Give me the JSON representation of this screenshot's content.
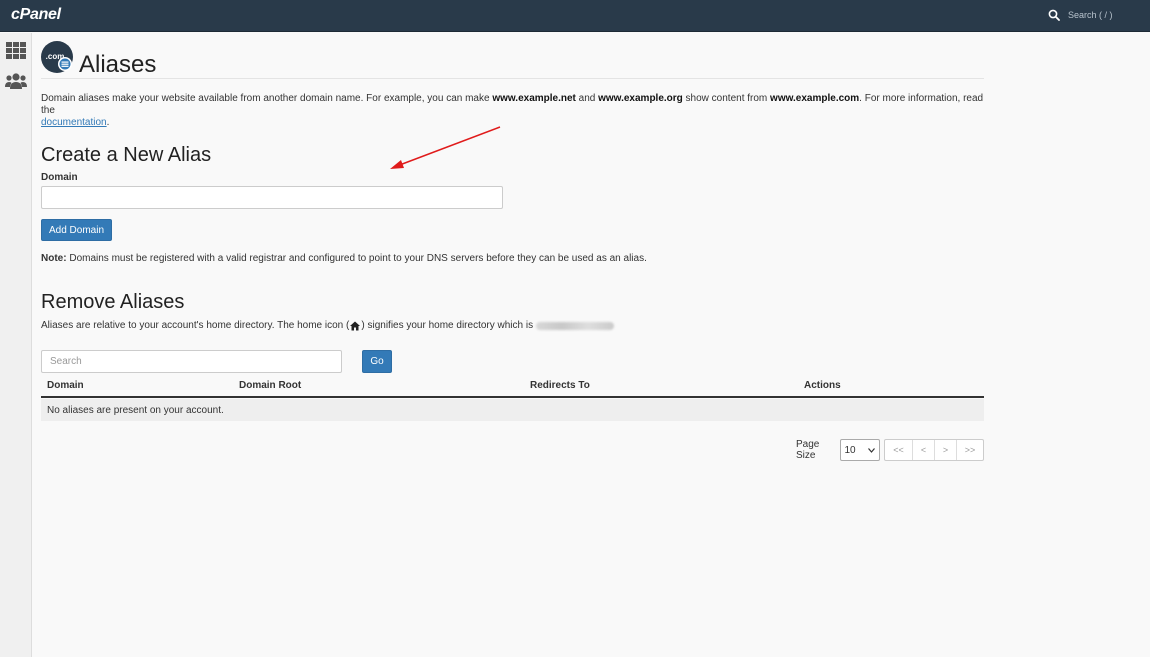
{
  "header": {
    "logo": "cPanel",
    "search_placeholder": "Search ( / )"
  },
  "sidebar": {
    "items": [
      {
        "icon": "grid-icon"
      },
      {
        "icon": "users-icon"
      }
    ]
  },
  "page": {
    "title": "Aliases",
    "title_icon": "domain-com-icon",
    "desc_part1": "Domain aliases make your website available from another domain name. For example, you can make ",
    "desc_example1": "www.example.net",
    "desc_and": " and ",
    "desc_example2": "www.example.org",
    "desc_part2": " show content from ",
    "desc_example3": "www.example.com",
    "desc_part3": ". For more information, read the ",
    "desc_link": "documentation",
    "desc_end": "."
  },
  "create": {
    "heading": "Create a New Alias",
    "domain_label": "Domain",
    "domain_value": "",
    "add_button": "Add Domain",
    "note_label": "Note:",
    "note_text": " Domains must be registered with a valid registrar and configured to point to your DNS servers before they can be used as an alias."
  },
  "remove": {
    "heading": "Remove Aliases",
    "desc_part1": "Aliases are relative to your account's home directory. The home icon (",
    "desc_part2": ") signifies your home directory which is ",
    "search_placeholder": "Search",
    "go_button": "Go"
  },
  "table": {
    "columns": [
      "Domain",
      "Domain Root",
      "Redirects To",
      "Actions"
    ],
    "empty_message": "No aliases are present on your account."
  },
  "pagination": {
    "page_size_label": "Page Size",
    "page_size_value": "10",
    "buttons": [
      "<<",
      "<",
      ">",
      ">>"
    ]
  },
  "colors": {
    "topbar": "#293a4a",
    "primary": "#337ab7",
    "annotation_arrow": "#e01b1b"
  }
}
